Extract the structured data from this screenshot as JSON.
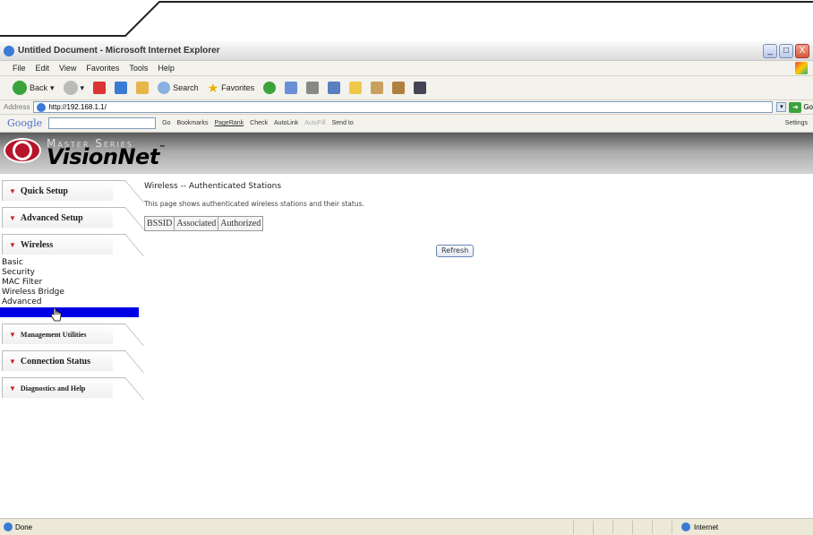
{
  "window": {
    "title": "Untitled Document - Microsoft Internet Explorer",
    "minimize": "_",
    "maximize": "□",
    "close": "X"
  },
  "menu": [
    "File",
    "Edit",
    "View",
    "Favorites",
    "Tools",
    "Help"
  ],
  "toolbar": {
    "back": "Back",
    "search": "Search",
    "favorites": "Favorites"
  },
  "address": {
    "label": "Address",
    "url": "http://192.168.1.1/",
    "go": "Go"
  },
  "google_bar": {
    "logo": "Google",
    "go": "Go",
    "bookmarks": "Bookmarks",
    "pagerank": "PageRank",
    "check": "Check",
    "autolink": "AutoLink",
    "autofill": "AutoFill",
    "send_to": "Send to",
    "settings": "Settings"
  },
  "banner": {
    "series": "Master Series",
    "brand": "VisionNet",
    "tm": "™"
  },
  "sidebar": {
    "tabs": [
      {
        "label": "Quick Setup"
      },
      {
        "label": "Advanced Setup"
      },
      {
        "label": "Wireless"
      }
    ],
    "wireless_items": [
      "Basic",
      "Security",
      "MAC Filter",
      "Wireless Bridge",
      "Advanced",
      ""
    ],
    "tabs_after": [
      {
        "label": "Management Utilities"
      },
      {
        "label": "Connection Status"
      },
      {
        "label": "Diagnostics and Help"
      }
    ]
  },
  "content": {
    "heading": "Wireless -- Authenticated Stations",
    "description": "This page shows authenticated wireless stations and their status.",
    "table_headers": [
      "BSSID",
      "Associated",
      "Authorized"
    ],
    "refresh_button": "Refresh"
  },
  "status": {
    "left": "Done",
    "zone": "Internet"
  }
}
